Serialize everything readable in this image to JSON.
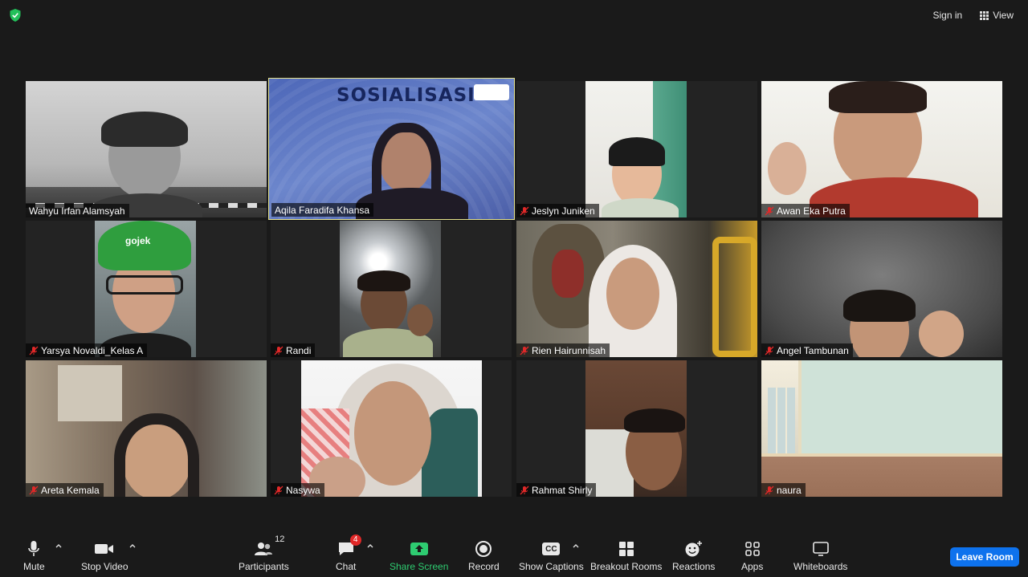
{
  "top_bar": {
    "sign_in_label": "Sign in",
    "view_label": "View"
  },
  "participants": [
    {
      "name": "Wahyu Irfan Alamsyah",
      "muted": false,
      "active": false
    },
    {
      "name": "Aqila Faradifa Khansa",
      "muted": false,
      "active": true,
      "slide_title": "SOSIALISASI"
    },
    {
      "name": "Jeslyn Juniken",
      "muted": true,
      "active": false
    },
    {
      "name": "Awan Eka Putra",
      "muted": true,
      "active": false
    },
    {
      "name": "Yarsya Novaldi_Kelas A",
      "muted": true,
      "active": false,
      "helmet_text": "gojek"
    },
    {
      "name": "Randi",
      "muted": true,
      "active": false
    },
    {
      "name": "Rien Hairunnisah",
      "muted": true,
      "active": false
    },
    {
      "name": "Angel Tambunan",
      "muted": true,
      "active": false
    },
    {
      "name": "Areta Kemala",
      "muted": true,
      "active": false
    },
    {
      "name": "Nasywa",
      "muted": true,
      "active": false
    },
    {
      "name": "Rahmat Shirly",
      "muted": true,
      "active": false
    },
    {
      "name": "naura",
      "muted": true,
      "active": false
    }
  ],
  "toolbar": {
    "mute_label": "Mute",
    "stop_video_label": "Stop Video",
    "participants_label": "Participants",
    "participants_count": "12",
    "chat_label": "Chat",
    "chat_badge": "4",
    "share_screen_label": "Share Screen",
    "record_label": "Record",
    "show_captions_label": "Show Captions",
    "captions_icon_text": "CC",
    "breakout_rooms_label": "Breakout Rooms",
    "reactions_label": "Reactions",
    "apps_label": "Apps",
    "whiteboards_label": "Whiteboards",
    "leave_room_label": "Leave Room"
  },
  "colors": {
    "background": "#1a1a1a",
    "active_speaker_border": "#e6e38c",
    "share_green": "#2ecc71",
    "leave_blue": "#0e72ed",
    "badge_red": "#e02828",
    "muted_red": "#e02828"
  }
}
